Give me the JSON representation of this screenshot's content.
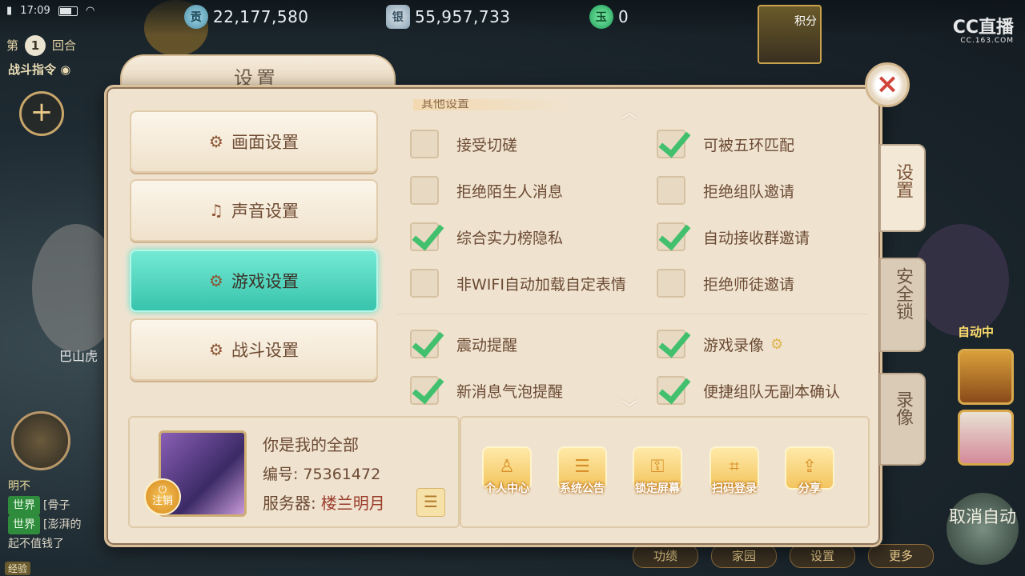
{
  "status_bar": {
    "time": "17:09"
  },
  "currencies": [
    {
      "icon": "contribution-icon",
      "glyph": "贡",
      "value": "22,177,580"
    },
    {
      "icon": "silver-icon",
      "glyph": "银",
      "value": "55,957,733"
    },
    {
      "icon": "jade-icon",
      "glyph": "玉",
      "value": "0"
    }
  ],
  "battle": {
    "round_prefix": "第",
    "round_num": "1",
    "round_suffix": "回合",
    "command": "战斗指令"
  },
  "npc_name": "巴山虎",
  "watermark": {
    "brand": "CC直播",
    "url": "CC.163.COM"
  },
  "score_label": "积分",
  "chat": [
    {
      "tag": "明不"
    },
    {
      "tag": "世界",
      "text": "[骨子"
    },
    {
      "tag": "世界",
      "text": "[澎湃的"
    },
    {
      "text": "起不值钱了"
    }
  ],
  "xp_label": "经验",
  "auto": {
    "label": "自动中",
    "cancel": "取消自动"
  },
  "bottom_tabs": [
    "功绩",
    "家园",
    "设置",
    "更多"
  ],
  "settings": {
    "title": "设置",
    "nav": [
      {
        "label": "画面设置",
        "icon": "graphics-gear-icon"
      },
      {
        "label": "声音设置",
        "icon": "music-note-icon"
      },
      {
        "label": "游戏设置",
        "icon": "game-gear-icon"
      },
      {
        "label": "战斗设置",
        "icon": "battle-gear-icon"
      }
    ],
    "partial_heading": "其他设置",
    "options": [
      {
        "label": "接受切磋",
        "checked": false
      },
      {
        "label": "可被五环匹配",
        "checked": true
      },
      {
        "label": "拒绝陌生人消息",
        "checked": false
      },
      {
        "label": "拒绝组队邀请",
        "checked": false
      },
      {
        "label": "综合实力榜隐私",
        "checked": true
      },
      {
        "label": "自动接收群邀请",
        "checked": true
      },
      {
        "label": "非WIFI自动加载自定表情",
        "checked": false
      },
      {
        "label": "拒绝师徒邀请",
        "checked": false
      },
      {
        "label": "震动提醒",
        "checked": true
      },
      {
        "label": "游戏录像",
        "checked": true
      },
      {
        "label": "新消息气泡提醒",
        "checked": true
      },
      {
        "label": "便捷组队无副本确认",
        "checked": true
      }
    ],
    "profile": {
      "name": "你是我的全部",
      "id_label": "编号:",
      "id": "75361472",
      "server_label": "服务器:",
      "server": "楼兰明月",
      "logout": "注销"
    },
    "actions": [
      {
        "label": "个人中心",
        "icon": "person-icon",
        "glyph": "♙"
      },
      {
        "label": "系统公告",
        "icon": "scroll-icon",
        "glyph": "☰"
      },
      {
        "label": "锁定屏幕",
        "icon": "key-icon",
        "glyph": "⚿"
      },
      {
        "label": "扫码登录",
        "icon": "scan-icon",
        "glyph": "⌗"
      },
      {
        "label": "分享",
        "icon": "share-icon",
        "glyph": "⇪"
      }
    ],
    "side_tabs": [
      {
        "label": "设置"
      },
      {
        "label": "安全锁"
      },
      {
        "label": "录像"
      }
    ]
  }
}
